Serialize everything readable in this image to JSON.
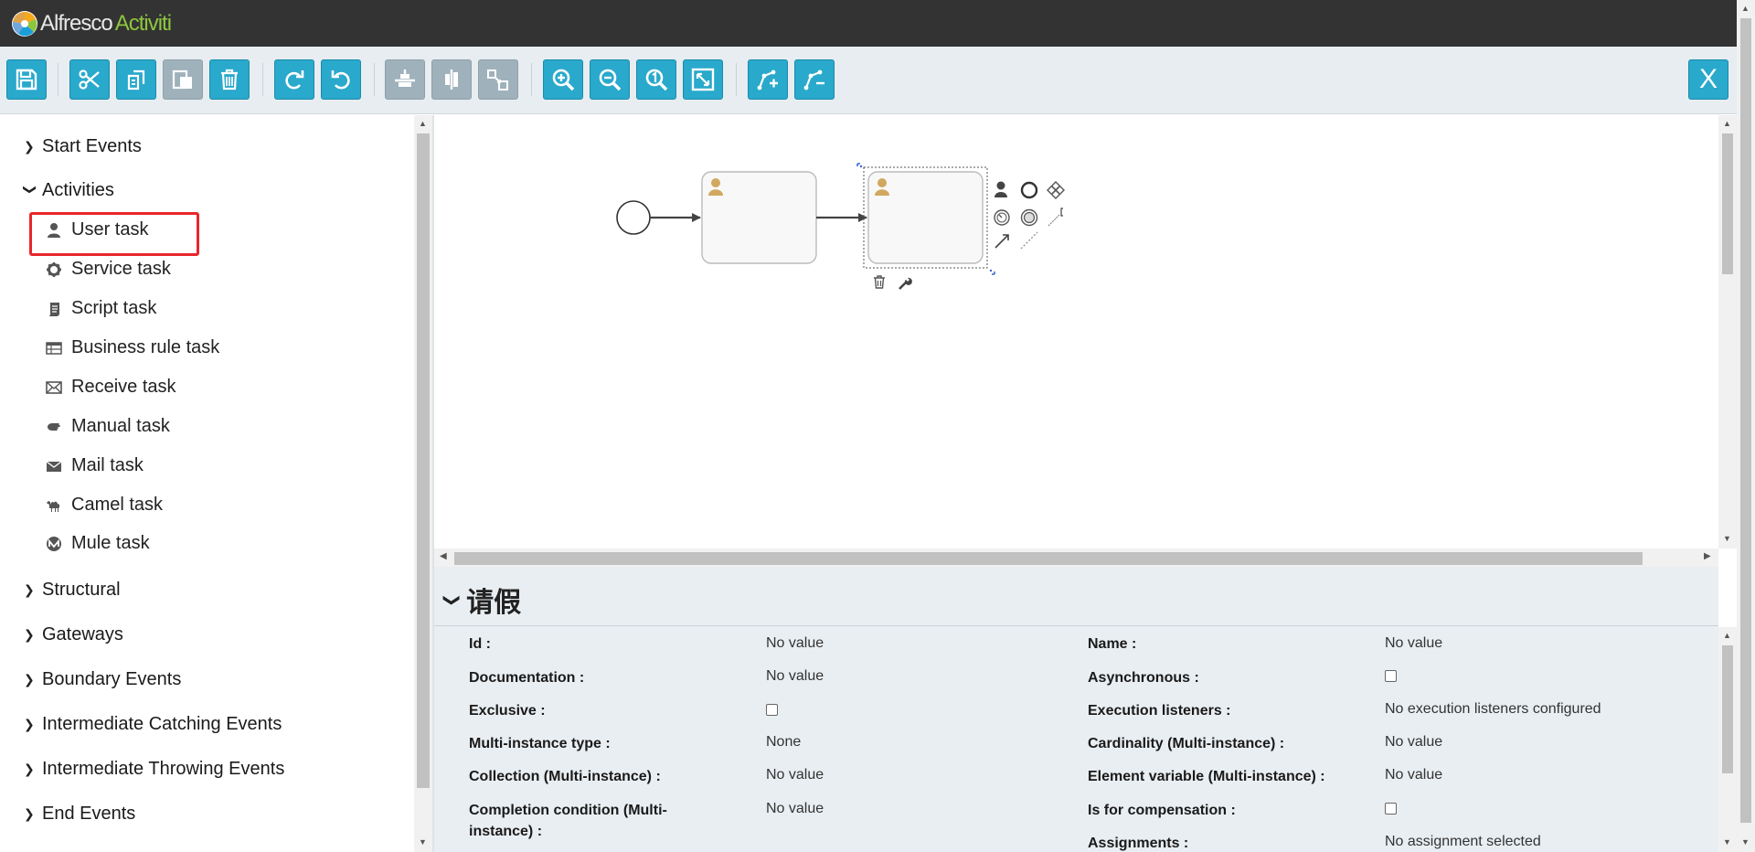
{
  "header": {
    "brand_alfresco": "Alfresco",
    "brand_activiti": "Activiti"
  },
  "toolbar": {
    "buttons": [
      {
        "name": "save-button",
        "icon": "floppy-disk-icon",
        "enabled": true
      },
      {
        "name": "cut-button",
        "icon": "scissors-icon",
        "enabled": true
      },
      {
        "name": "copy-button",
        "icon": "copy-icon",
        "enabled": true
      },
      {
        "name": "paste-button",
        "icon": "paste-icon",
        "enabled": false
      },
      {
        "name": "delete-button",
        "icon": "trash-icon",
        "enabled": true
      },
      {
        "name": "redo-button",
        "icon": "redo-icon",
        "enabled": true
      },
      {
        "name": "undo-button",
        "icon": "undo-icon",
        "enabled": true
      },
      {
        "name": "align-vertical-button",
        "icon": "align-vertical-icon",
        "enabled": false
      },
      {
        "name": "align-horizontal-button",
        "icon": "align-horizontal-icon",
        "enabled": false
      },
      {
        "name": "same-size-button",
        "icon": "same-size-icon",
        "enabled": false
      },
      {
        "name": "zoom-in-button",
        "icon": "zoom-in-icon",
        "enabled": true
      },
      {
        "name": "zoom-out-button",
        "icon": "zoom-out-icon",
        "enabled": true
      },
      {
        "name": "zoom-actual-button",
        "icon": "zoom-actual-icon",
        "enabled": true
      },
      {
        "name": "zoom-fit-button",
        "icon": "zoom-fit-icon",
        "enabled": true
      },
      {
        "name": "add-bendpoint-button",
        "icon": "add-bendpoint-icon",
        "enabled": true
      },
      {
        "name": "remove-bendpoint-button",
        "icon": "remove-bendpoint-icon",
        "enabled": true
      }
    ],
    "close_label": "X"
  },
  "palette": {
    "groups": [
      {
        "label": "Start Events",
        "expanded": false
      },
      {
        "label": "Activities",
        "expanded": true
      },
      {
        "label": "Structural",
        "expanded": false
      },
      {
        "label": "Gateways",
        "expanded": false
      },
      {
        "label": "Boundary Events",
        "expanded": false
      },
      {
        "label": "Intermediate Catching Events",
        "expanded": false
      },
      {
        "label": "Intermediate Throwing Events",
        "expanded": false
      },
      {
        "label": "End Events",
        "expanded": false
      }
    ],
    "activities": [
      {
        "label": "User task",
        "icon": "user-icon"
      },
      {
        "label": "Service task",
        "icon": "gear-icon"
      },
      {
        "label": "Script task",
        "icon": "script-icon"
      },
      {
        "label": "Business rule task",
        "icon": "table-icon"
      },
      {
        "label": "Receive task",
        "icon": "envelope-open-icon"
      },
      {
        "label": "Manual task",
        "icon": "hand-icon"
      },
      {
        "label": "Mail task",
        "icon": "envelope-icon"
      },
      {
        "label": "Camel task",
        "icon": "camel-icon"
      },
      {
        "label": "Mule task",
        "icon": "mule-icon"
      }
    ],
    "highlighted_item": "User task"
  },
  "properties": {
    "title": "请假",
    "left": [
      {
        "label": "Id :",
        "value": "No value",
        "type": "text"
      },
      {
        "label": "Documentation :",
        "value": "No value",
        "type": "text"
      },
      {
        "label": "Exclusive :",
        "value": "",
        "type": "checkbox"
      },
      {
        "label": "Multi-instance type :",
        "value": "None",
        "type": "text"
      },
      {
        "label": "Collection (Multi-instance) :",
        "value": "No value",
        "type": "text"
      },
      {
        "label": "Completion condition (Multi-",
        "label2": "instance) :",
        "value": "No value",
        "type": "text"
      }
    ],
    "right": [
      {
        "label": "Name :",
        "value": "No value",
        "type": "text"
      },
      {
        "label": "Asynchronous :",
        "value": "",
        "type": "checkbox"
      },
      {
        "label": "Execution listeners :",
        "value": "No execution listeners configured",
        "type": "text"
      },
      {
        "label": "Cardinality (Multi-instance) :",
        "value": "No value",
        "type": "text"
      },
      {
        "label": "Element variable (Multi-instance) :",
        "value": "No value",
        "type": "text"
      },
      {
        "label": "Is for compensation :",
        "value": "",
        "type": "checkbox"
      },
      {
        "label": "Assignments :",
        "value": "No assignment selected",
        "type": "text"
      }
    ]
  },
  "colors": {
    "header_bg": "#333333",
    "toolbar_bg": "#e8edf1",
    "button_blue": "#29a9cc",
    "button_disabled": "#9fb1bb",
    "highlight_red": "#e8262b",
    "user_icon_gold": "#d1a85f"
  }
}
